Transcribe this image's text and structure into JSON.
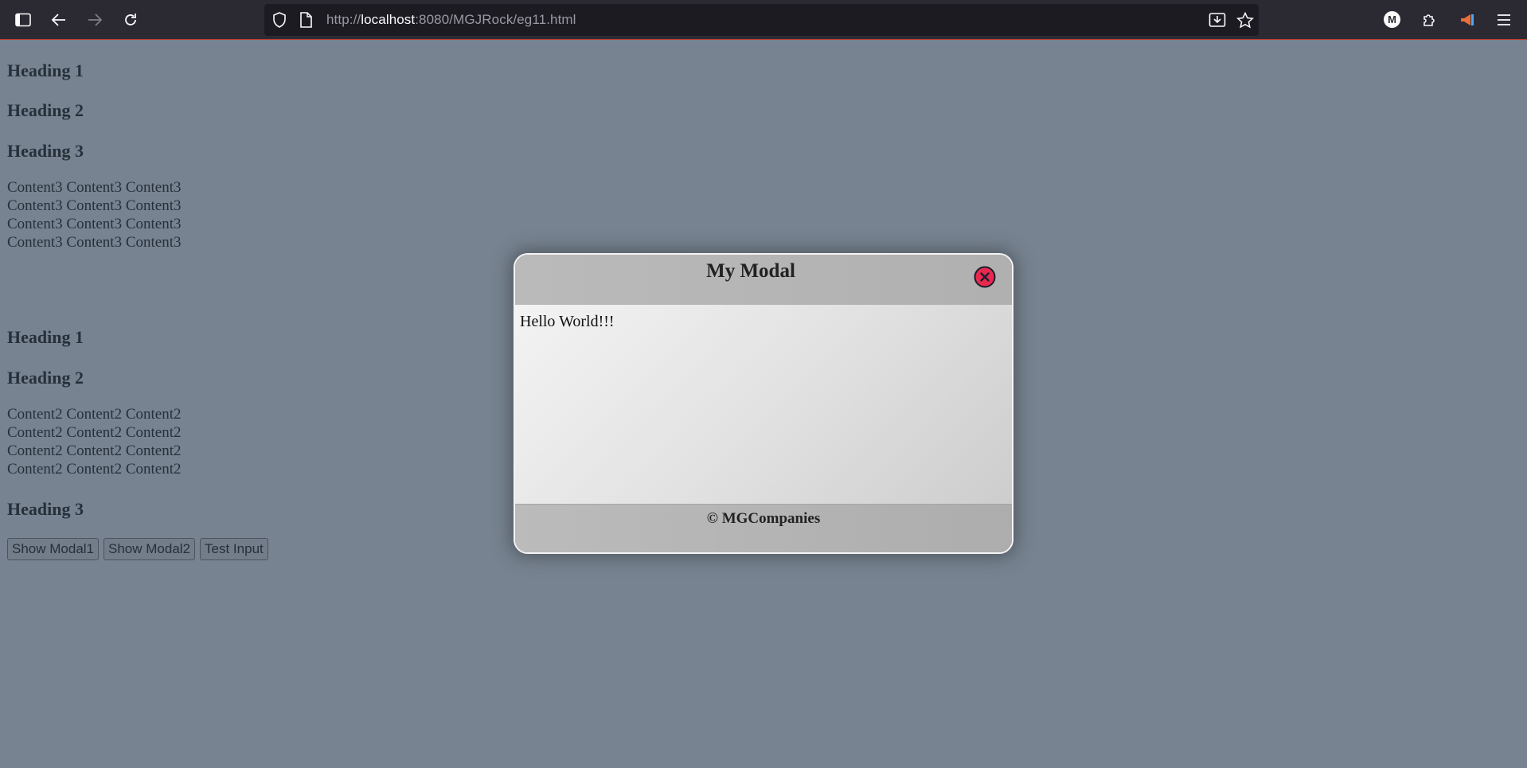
{
  "browser": {
    "url_prefix": "http://",
    "url_host": "localhost",
    "url_rest": ":8080/MGJRock/eg11.html",
    "account_initial": "M"
  },
  "page": {
    "section1": {
      "headings": [
        "Heading 1",
        "Heading 2",
        "Heading 3"
      ],
      "content": [
        "Content3 Content3 Content3",
        "Content3 Content3 Content3",
        "Content3 Content3 Content3",
        "Content3 Content3 Content3"
      ]
    },
    "section2": {
      "headings": [
        "Heading 1",
        "Heading 2"
      ],
      "content": [
        "Content2 Content2 Content2",
        "Content2 Content2 Content2",
        "Content2 Content2 Content2",
        "Content2 Content2 Content2"
      ],
      "heading_after": "Heading 3"
    },
    "buttons": [
      "Show Modal1",
      "Show Modal2",
      "Test Input"
    ]
  },
  "modal": {
    "title": "My Modal",
    "body_text": "Hello World!!!",
    "footer_text": "© MGCompanies",
    "close_color": "#e8294f"
  },
  "colors": {
    "page_bg": "#778390",
    "chrome_bg": "#2b2a33"
  }
}
